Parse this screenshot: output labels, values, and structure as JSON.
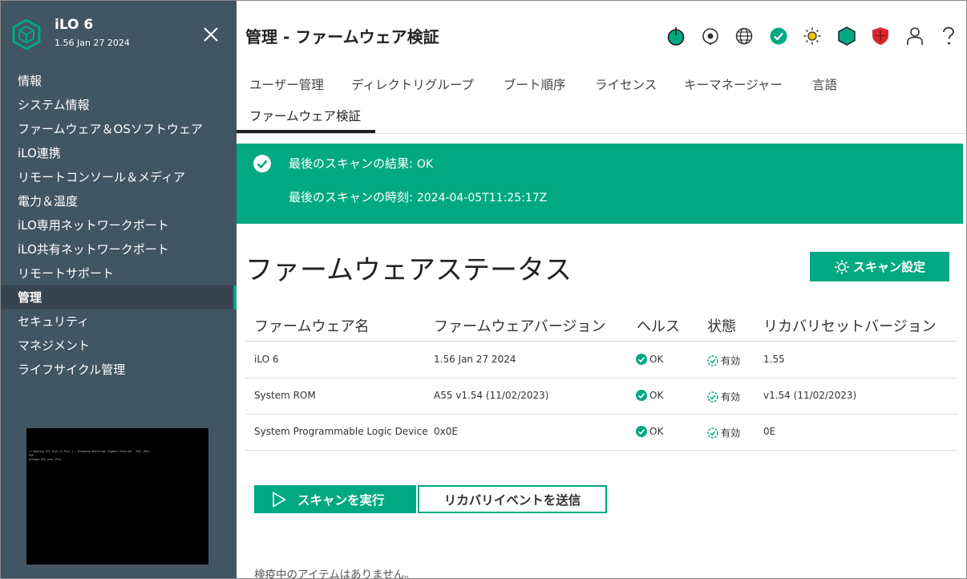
{
  "colors": {
    "sidebar_bg": "#425563",
    "accent": "#01a982",
    "nav_active_bg": "#36444f",
    "alert_red": "#d9282e"
  },
  "sidebar": {
    "title": "iLO 6",
    "subtitle": "1.56 Jan 27 2024",
    "close_icon": "close-icon",
    "items": [
      {
        "label": "情報"
      },
      {
        "label": "システム情報"
      },
      {
        "label": "ファームウェア＆OSソフトウェア"
      },
      {
        "label": "iLO連携"
      },
      {
        "label": "リモートコンソール＆メディア"
      },
      {
        "label": "電力＆温度"
      },
      {
        "label": "iLO専用ネットワークポート"
      },
      {
        "label": "iLO共有ネットワークポート"
      },
      {
        "label": "リモートサポート"
      },
      {
        "label": "管理",
        "active": true
      },
      {
        "label": "セキュリティ"
      },
      {
        "label": "マネジメント"
      },
      {
        "label": "ライフサイクル管理"
      }
    ],
    "console_lines": [
      ">> Booting PCI Slot 21 Port 1 : Broadcom NetXtreme Gigabit Ethernet - NIC (BIO...",
      "PXE",
      "",
      "Attempt PXE over IPv4."
    ]
  },
  "header": {
    "title": "管理 - ファームウェア検証",
    "icons": [
      "power-icon",
      "location-icon",
      "globe-icon",
      "health-ok-icon",
      "uid-light-icon",
      "security-shield-icon",
      "security-alert-icon",
      "user-icon",
      "help-icon"
    ]
  },
  "tabs": [
    {
      "label": "ユーザー管理"
    },
    {
      "label": "ディレクトリグループ"
    },
    {
      "label": "ブート順序"
    },
    {
      "label": "ライセンス"
    },
    {
      "label": "キーマネージャー"
    },
    {
      "label": "言語"
    },
    {
      "label": "ファームウェア検証",
      "active": true
    }
  ],
  "banner": {
    "result_label": "最後のスキャンの結果:",
    "result_value": "OK",
    "time_label": "最後のスキャンの時刻:",
    "time_value": "2024-04-05T11:25:17Z"
  },
  "section": {
    "title": "ファームウェアステータス",
    "scan_settings_label": "スキャン設定"
  },
  "table": {
    "columns": [
      "ファームウェア名",
      "ファームウェアバージョン",
      "ヘルス",
      "状態",
      "リカバリセットバージョン"
    ],
    "rows": [
      {
        "name": "iLO 6",
        "version": "1.56 Jan 27 2024",
        "health": "OK",
        "state": "有効",
        "recovery": "1.55"
      },
      {
        "name": "System ROM",
        "version": "A55 v1.54 (11/02/2023)",
        "health": "OK",
        "state": "有効",
        "recovery": "v1.54 (11/02/2023)"
      },
      {
        "name": "System Programmable Logic Device",
        "version": "0x0E",
        "health": "OK",
        "state": "有効",
        "recovery": "0E"
      }
    ]
  },
  "actions": {
    "run_scan_label": "スキャンを実行",
    "send_recovery_label": "リカバリイベントを送信"
  },
  "quarantine_text": "検疫中のアイテムはありません。"
}
